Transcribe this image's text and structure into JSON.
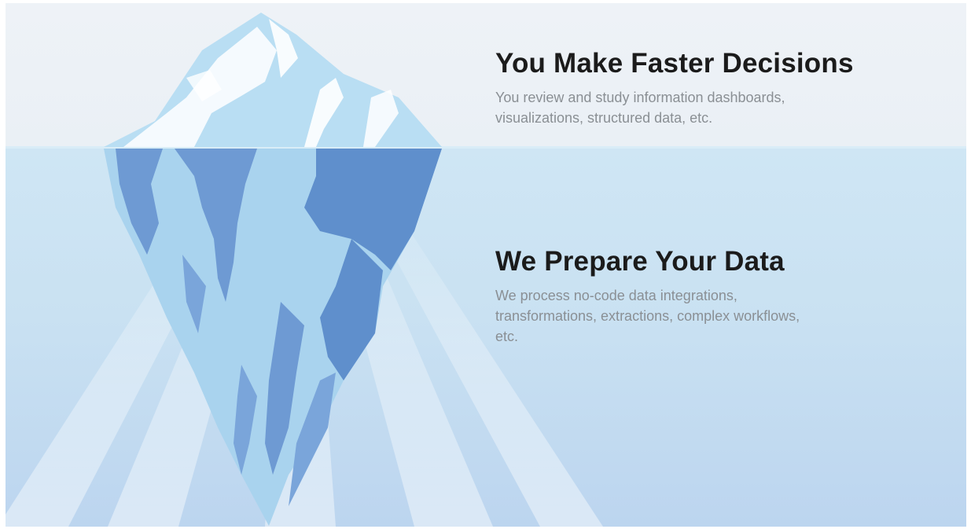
{
  "top": {
    "heading": "You Make Faster Decisions",
    "description": "You review and study information dashboards, visualizations, structured data, etc."
  },
  "bottom": {
    "heading": "We Prepare Your Data",
    "description": "We process no-code data integrations, transformations, extractions, complex workflows, etc."
  },
  "colors": {
    "sky": "#eef2f7",
    "sea": "#c9e1f2",
    "ice_light": "#d7eefa",
    "ice_mid": "#a9d3ee",
    "ice_dark": "#5f8fcc",
    "heading": "#1b1b1b",
    "body_text": "#8a8f94"
  }
}
